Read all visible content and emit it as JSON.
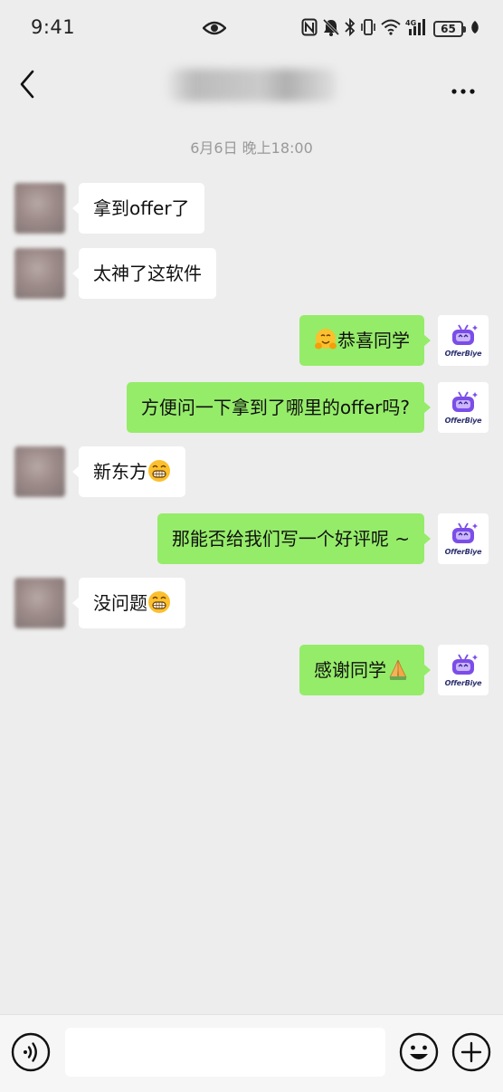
{
  "status_bar": {
    "time": "9:41",
    "signal_label": "4G",
    "battery_level": "65",
    "icons": [
      "eye-icon",
      "nfc-icon",
      "mute-icon",
      "bluetooth-icon",
      "vibrate-icon",
      "wifi-icon",
      "signal-icon",
      "battery-icon",
      "leaf-icon"
    ]
  },
  "header": {
    "title": "",
    "back_icon": "chevron-left-icon",
    "more_icon": "more-dots-icon"
  },
  "chat": {
    "timestamp": "6月6日 晚上18:00",
    "partner_avatar_brand": "OfferBiye",
    "messages": [
      {
        "side": "left",
        "text": "拿到offer了",
        "emoji": null
      },
      {
        "side": "left",
        "text": "太神了这软件",
        "emoji": null
      },
      {
        "side": "right",
        "text": "恭喜同学",
        "emoji": "hugging-face-emoji",
        "emoji_position": "before"
      },
      {
        "side": "right",
        "text": "方便问一下拿到了哪里的offer吗?",
        "emoji": null
      },
      {
        "side": "left",
        "text": "新东方",
        "emoji": "grinning-face-emoji",
        "emoji_position": "after"
      },
      {
        "side": "right",
        "text": "那能否给我们写一个好评呢 ~",
        "emoji": null
      },
      {
        "side": "left",
        "text": "没问题",
        "emoji": "grinning-face-emoji",
        "emoji_position": "after"
      },
      {
        "side": "right",
        "text": "感谢同学",
        "emoji": "folded-hands-emoji",
        "emoji_position": "after"
      }
    ]
  },
  "input_bar": {
    "placeholder": "",
    "voice_icon": "voice-icon",
    "emoji_icon": "smile-icon",
    "plus_icon": "plus-icon"
  },
  "colors": {
    "background": "#ededed",
    "bubble_sent": "#95ec69",
    "bubble_received": "#ffffff",
    "timestamp": "#999999",
    "brand_purple": "#7b4de8"
  }
}
